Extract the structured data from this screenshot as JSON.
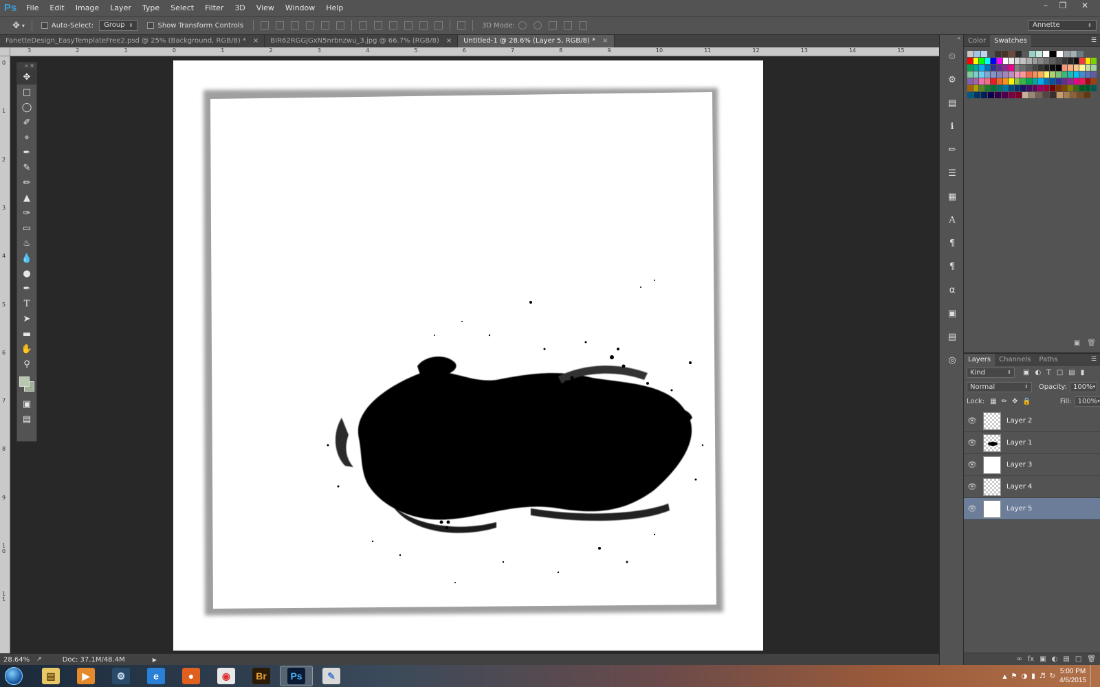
{
  "app": {
    "logo": "Ps",
    "title": "Adobe Photoshop CS6"
  },
  "menu": [
    "File",
    "Edit",
    "Image",
    "Layer",
    "Type",
    "Select",
    "Filter",
    "3D",
    "View",
    "Window",
    "Help"
  ],
  "options": {
    "auto_select_label": "Auto-Select:",
    "auto_select_value": "Group",
    "transform_label": "Show Transform Controls",
    "mode_label": "3D Mode:",
    "workspace": "Annette"
  },
  "tabs": [
    {
      "label": "FanetteDesign_EasyTemplateFree2.psd @ 25% (Background, RGB/8) *",
      "active": false
    },
    {
      "label": "BIR62RGGjGxN5nrbnzwu_3.jpg @ 66.7% (RGB/8)",
      "active": false
    },
    {
      "label": "Untitled-1 @ 28.6% (Layer 5, RGB/8) *",
      "active": true
    }
  ],
  "ruler_h": [
    "3",
    "2",
    "1",
    "0",
    "1",
    "2",
    "3",
    "4",
    "5",
    "6",
    "7",
    "8",
    "9",
    "10",
    "11",
    "12",
    "13",
    "14",
    "15"
  ],
  "ruler_v": [
    "0",
    "1",
    "2",
    "3",
    "4",
    "5",
    "6",
    "7",
    "8",
    "9",
    "1\n0",
    "1\n1"
  ],
  "status": {
    "zoom": "28.64%",
    "doc": "Doc: 37.1M/48.4M"
  },
  "color_panel": {
    "tabs": [
      "Color",
      "Swatches"
    ],
    "active_tab": "Swatches"
  },
  "swatch_rows": [
    [
      "#c8c8c8",
      "#9fc6e6",
      "#bcd4f0",
      "#555555",
      "#3c3530",
      "#4a342a",
      "#6a4a3a",
      "#2a2a2a",
      "#5a5a5a",
      "#9ad0c8",
      "#c4eae0",
      "#ffffff",
      "#000000",
      "#ffffff",
      "#9aa4a8",
      "#a4b0b4",
      "#6c7c84"
    ],
    [
      "#ff0000",
      "#ffff00",
      "#00ff00",
      "#00ffff",
      "#0000ff",
      "#ff00ff",
      "#ffffff",
      "#ebebeb",
      "#d7d7d7",
      "#c3c3c3",
      "#afafaf",
      "#9b9b9b",
      "#878787",
      "#737373",
      "#5f5f5f",
      "#4b4b4b",
      "#373737",
      "#232323",
      "#0f0f0f",
      "#f23a3a",
      "#ffe600",
      "#7cd300"
    ],
    [
      "#00a651",
      "#00a99d",
      "#00aeef",
      "#0072bc",
      "#2e3192",
      "#662d91",
      "#92278f",
      "#ec008c",
      "#808080",
      "#6d6d6d",
      "#595959",
      "#464646",
      "#333333",
      "#202020",
      "#0d0d0d",
      "#000000",
      "#f7977a",
      "#f9ad81",
      "#fdc68a",
      "#fff79a",
      "#c4df9b",
      "#a3d39c"
    ],
    [
      "#82ca9d",
      "#7bcdc8",
      "#6ecff6",
      "#7ea7d8",
      "#8493ca",
      "#8882be",
      "#a187be",
      "#bc8dbf",
      "#f49ac2",
      "#f6989d",
      "#f26c4f",
      "#f68e55",
      "#fbaf5c",
      "#fff467",
      "#acd372",
      "#7cc576",
      "#3bb878",
      "#1abbb4",
      "#00bff3",
      "#438ccb",
      "#5574b9",
      "#605ca8"
    ],
    [
      "#855fa8",
      "#a763a8",
      "#f06ea9",
      "#f26d7d",
      "#ed1c24",
      "#f26522",
      "#f7941d",
      "#fff200",
      "#8dc63f",
      "#39b54a",
      "#00a651",
      "#00a99d",
      "#00aeef",
      "#0072bc",
      "#0054a6",
      "#2e3192",
      "#662d91",
      "#92278f",
      "#ec008c",
      "#ed145b",
      "#9e0b0f",
      "#a0410d"
    ],
    [
      "#a3620a",
      "#aba000",
      "#598527",
      "#1a7b30",
      "#007236",
      "#00746b",
      "#0076a3",
      "#004b80",
      "#003471",
      "#1b1464",
      "#440e62",
      "#630460",
      "#9e005d",
      "#9e0039",
      "#790000",
      "#7b2e00",
      "#7d4900",
      "#827b00",
      "#406618",
      "#005e20",
      "#005826",
      "#005952"
    ],
    [
      "#005b7f",
      "#003663",
      "#002157",
      "#0d004c",
      "#32004b",
      "#4b0049",
      "#7b0046",
      "#7a0026",
      "#c7b299",
      "#998675",
      "#736357",
      "#534741",
      "#37302d",
      "#c69c6d",
      "#a67c52",
      "#8c6239",
      "#754c24",
      "#603913"
    ]
  ],
  "layers_panel": {
    "tabs": [
      "Layers",
      "Channels",
      "Paths"
    ],
    "active_tab": "Layers",
    "filter": "Kind",
    "blend": "Normal",
    "opacity_label": "Opacity:",
    "opacity": "100%",
    "lock_label": "Lock:",
    "fill_label": "Fill:",
    "fill": "100%",
    "layers": [
      {
        "name": "Layer 2",
        "thumb": "transparent",
        "selected": false
      },
      {
        "name": "Layer 1",
        "thumb": "blob",
        "selected": false
      },
      {
        "name": "Layer 3",
        "thumb": "white",
        "selected": false
      },
      {
        "name": "Layer 4",
        "thumb": "transparent",
        "selected": false
      },
      {
        "name": "Layer 5",
        "thumb": "white",
        "selected": true
      }
    ]
  },
  "taskbar": {
    "apps": [
      {
        "name": "file-explorer",
        "label": ""
      },
      {
        "name": "media-player",
        "label": ""
      },
      {
        "name": "steam",
        "label": ""
      },
      {
        "name": "internet-explorer",
        "label": ""
      },
      {
        "name": "firefox",
        "label": ""
      },
      {
        "name": "chrome",
        "label": ""
      },
      {
        "name": "bridge",
        "label": "Br"
      },
      {
        "name": "photoshop",
        "label": "Ps"
      },
      {
        "name": "paint",
        "label": ""
      }
    ],
    "time": "5:00 PM",
    "date": "4/6/2015"
  },
  "colors": {
    "fg": "#b8c8ae",
    "bg": "#9fb096",
    "selection": "#6c7d9a"
  }
}
